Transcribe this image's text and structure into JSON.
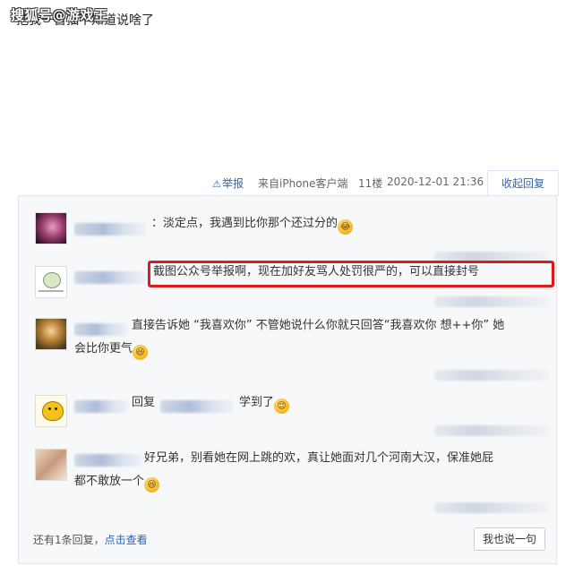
{
  "watermark": "搜狐号@游戏王",
  "top_text": "把我一首抽不知道说啥了",
  "post_meta": {
    "report_label": "举报",
    "client": "来自iPhone客户端",
    "floor": "11楼",
    "time": "2020-12-01 21:36",
    "collapse_label": "收起回复"
  },
  "replies": [
    {
      "text": "淡定点，我遇到比你那个还过分的",
      "emoji": "cry-laugh-emoji"
    },
    {
      "text": "截图公众号举报啊，现在加好友骂人处罚很严的，可以直接封号"
    },
    {
      "text_line1": "直接告诉她 “我喜欢你” 不管她说什么你就只回答“我喜欢你 想++你” 她",
      "text_line2": "会比你更气",
      "emoji": "laugh-emoji"
    },
    {
      "prefix": "回复",
      "text": "学到了",
      "emoji": "smile-emoji"
    },
    {
      "text_line1": "好兄弟，别看她在网上跳的欢，真让她面对几个河南大汉，保准她屁",
      "text_line2": "都不敢放一个",
      "emoji": "laugh-emoji"
    }
  ],
  "footer": {
    "more_text": "还有1条回复，",
    "more_link": "点击查看",
    "say_button": "我也说一句"
  },
  "colors": {
    "link": "#2d64b3",
    "highlight": "#e0191e",
    "panel_bg": "#f7f8fa"
  }
}
